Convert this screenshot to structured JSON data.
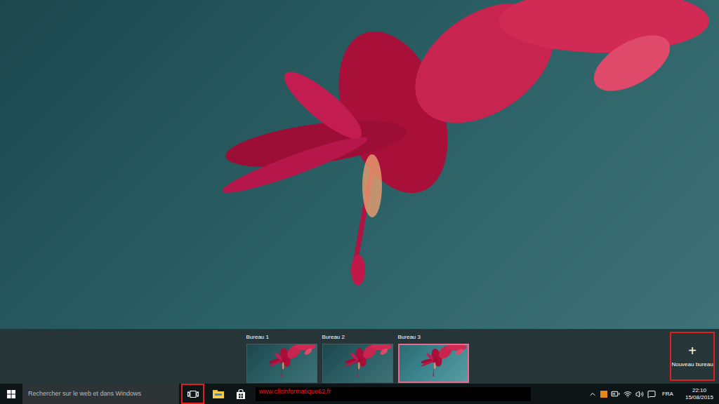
{
  "desktops": [
    {
      "label": "Bureau 1",
      "selected": false
    },
    {
      "label": "Bureau 2",
      "selected": false
    },
    {
      "label": "Bureau 3",
      "selected": true
    }
  ],
  "new_desktop": {
    "icon": "+",
    "label": "Nouveau bureau",
    "highlighted": true
  },
  "taskbar": {
    "search": {
      "placeholder": "Rechercher sur le web et dans Windows"
    },
    "task_view_highlighted": true,
    "watermark": "www.clicinformatique62.fr",
    "tray": {
      "language": "FRA",
      "time": "22:10",
      "date": "15/08/2015"
    }
  }
}
